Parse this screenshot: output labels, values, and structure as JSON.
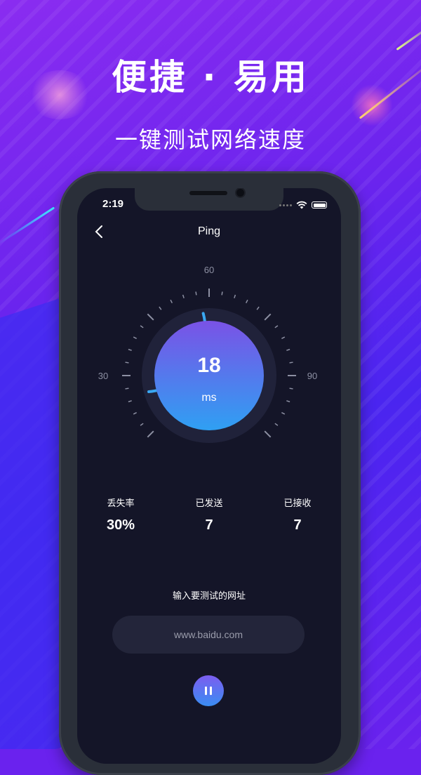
{
  "promo": {
    "headline": "便捷 · 易用",
    "subline": "一键测试网络速度"
  },
  "status_bar": {
    "time": "2:19"
  },
  "nav": {
    "title": "Ping"
  },
  "gauge": {
    "min_label": "30",
    "mid_label": "60",
    "max_label": "90",
    "value": "18",
    "unit": "ms",
    "progress_fraction": 0.25
  },
  "stats": [
    {
      "label": "丢失率",
      "value": "30%"
    },
    {
      "label": "已发送",
      "value": "7"
    },
    {
      "label": "已接收",
      "value": "7"
    }
  ],
  "input": {
    "prompt": "输入要测试的网址",
    "value": "www.baidu.com"
  },
  "colors": {
    "accent": "#3a8df2",
    "screen_bg": "#141528"
  }
}
